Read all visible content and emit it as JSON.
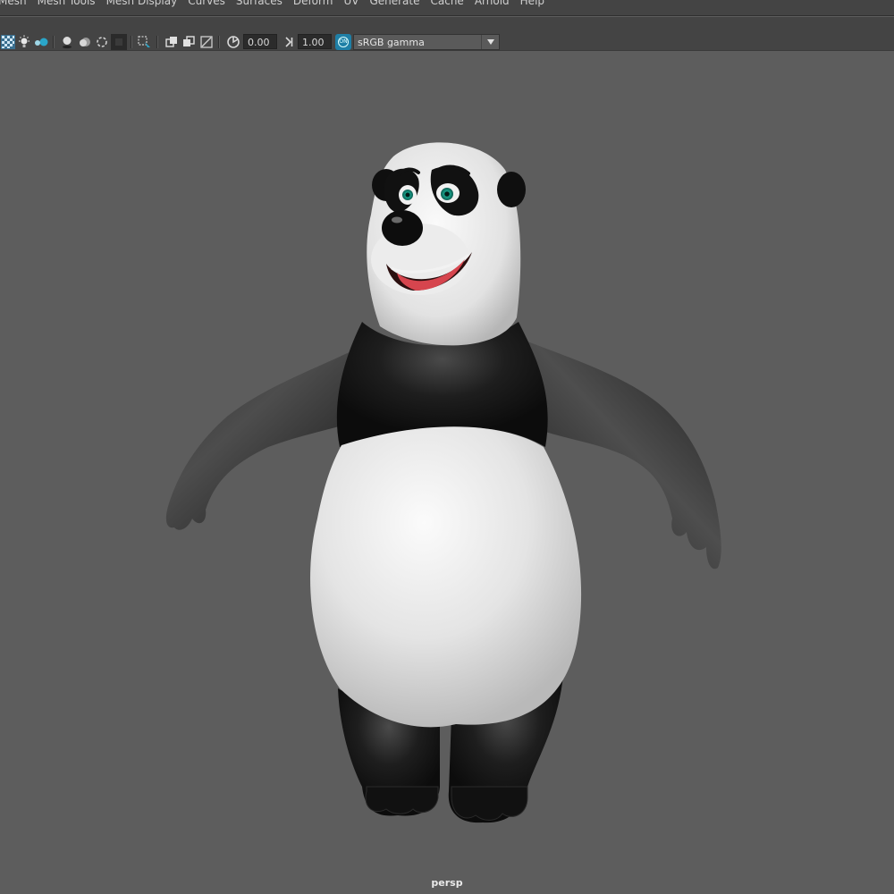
{
  "menubar": {
    "items": [
      "Mesh",
      "Mesh Tools",
      "Mesh Display",
      "Curves",
      "Surfaces",
      "Deform",
      "UV",
      "Generate",
      "Cache",
      "Arnold",
      "Help"
    ]
  },
  "toolbar": {
    "exposure_value": "0.00",
    "gamma_value": "1.00",
    "color_space": "sRGB gamma",
    "color_management_badge": "ON",
    "icons": [
      "checker-icon",
      "light-icon",
      "ao-icon",
      "shadow-icon",
      "sphere-icon",
      "motion-blur-icon",
      "aa-icon",
      "square-icon",
      "isolate-icon",
      "frame-icon",
      "grid-icon",
      "camera-icon",
      "gate-icon",
      "exposure-icon",
      "gamma-icon"
    ]
  },
  "viewport": {
    "camera": "persp",
    "accent": "#1f7fa6",
    "background": "#5d5d5d"
  }
}
